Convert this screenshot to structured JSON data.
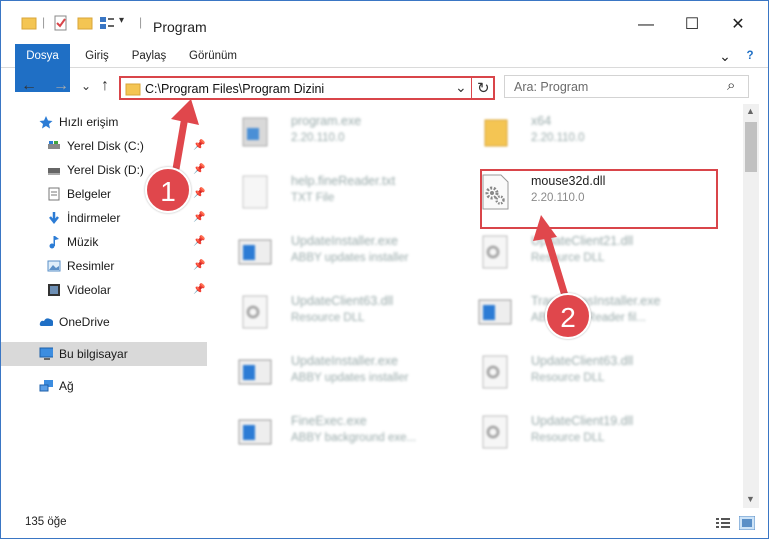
{
  "window": {
    "title": "Program",
    "minimize": "—",
    "maximize": "☐",
    "close": "✕"
  },
  "ribbon": {
    "tabs": [
      "Dosya",
      "Giriş",
      "Paylaş",
      "Görünüm"
    ],
    "expand": "⌄",
    "help": "?"
  },
  "nav": {
    "back": "←",
    "forward": "→",
    "recent": "⌄",
    "up": "↑",
    "address": "C:\\Program Files\\Program Dizini",
    "address_dropdown": "⌄",
    "refresh": "↻",
    "search_placeholder": "Ara: Program",
    "search_icon": "⌕"
  },
  "sidebar": {
    "items": [
      {
        "label": "Hızlı erişim",
        "icon": "star-icon",
        "pinned": false
      },
      {
        "label": "Yerel Disk (C:)",
        "icon": "drive-icon",
        "pinned": true
      },
      {
        "label": "Yerel Disk (D:)",
        "icon": "drive-icon",
        "pinned": true
      },
      {
        "label": "Belgeler",
        "icon": "document-icon",
        "pinned": true
      },
      {
        "label": "İndirmeler",
        "icon": "download-icon",
        "pinned": true
      },
      {
        "label": "Müzik",
        "icon": "music-icon",
        "pinned": true
      },
      {
        "label": "Resimler",
        "icon": "pictures-icon",
        "pinned": true
      },
      {
        "label": "Videolar",
        "icon": "video-icon",
        "pinned": true
      },
      {
        "label": "OneDrive",
        "icon": "cloud-icon",
        "pinned": false
      },
      {
        "label": "Bu bilgisayar",
        "icon": "computer-icon",
        "pinned": false,
        "selected": true
      },
      {
        "label": "Ağ",
        "icon": "network-icon",
        "pinned": false
      }
    ]
  },
  "files": [
    {
      "name": "program.exe",
      "sub": "2.20.110.0",
      "icon": "exe-icon"
    },
    {
      "name": "x64",
      "sub": "2.20.110.0",
      "icon": "folder-icon"
    },
    {
      "name": "help.fineReader.txt",
      "sub": "TXT File",
      "icon": "txt-icon"
    },
    {
      "name": "mouse32d.dll",
      "sub": "2.20.110.0",
      "icon": "dll-icon"
    },
    {
      "name": "UpdateInstaller.exe",
      "sub": "ABBY updates installer",
      "icon": "window-icon"
    },
    {
      "name": "UpdateClient21.dll",
      "sub": "Resource DLL",
      "icon": "dll-icon"
    },
    {
      "name": "UpdateClient63.dll",
      "sub": "Resource DLL",
      "icon": "dll-icon"
    },
    {
      "name": "TransformsInstaller.exe",
      "sub": "ABBY FineReader fil...",
      "icon": "window-icon"
    },
    {
      "name": "UpdateInstaller.exe",
      "sub": "ABBY updates installer",
      "icon": "window-icon"
    },
    {
      "name": "UpdateClient63.dll",
      "sub": "Resource DLL",
      "icon": "dll-icon"
    },
    {
      "name": "FineExec.exe",
      "sub": "ABBY background exe...",
      "icon": "window-icon"
    },
    {
      "name": "UpdateClient19.dll",
      "sub": "Resource DLL",
      "icon": "dll-icon"
    }
  ],
  "status": {
    "count": "135 öğe"
  },
  "annotations": {
    "step1": "1",
    "step2": "2",
    "color": "#e0474c"
  }
}
